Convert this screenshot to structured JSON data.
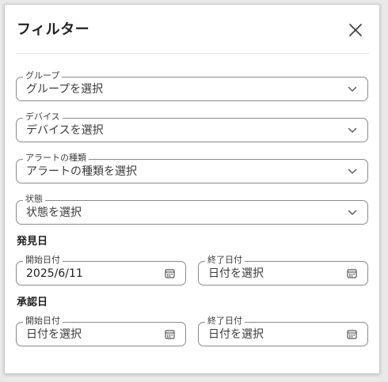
{
  "dialog": {
    "title": "フィルター",
    "close_icon": "close-icon"
  },
  "filters": {
    "group": {
      "label": "グループ",
      "placeholder": "グループを選択"
    },
    "device": {
      "label": "デバイス",
      "placeholder": "デバイスを選択"
    },
    "alert_type": {
      "label": "アラートの種類",
      "placeholder": "アラートの種類を選択"
    },
    "status": {
      "label": "状態",
      "placeholder": "状態を選択"
    }
  },
  "discovery_date": {
    "heading": "発見日",
    "start": {
      "label": "開始日付",
      "value": "2025/6/11"
    },
    "end": {
      "label": "終了日付",
      "placeholder": "日付を選択"
    }
  },
  "approval_date": {
    "heading": "承認日",
    "start": {
      "label": "開始日付",
      "placeholder": "日付を選択"
    },
    "end": {
      "label": "終了日付",
      "placeholder": "日付を選択"
    }
  },
  "icons": {
    "dropdown": "chevron-down-icon",
    "date": "calendar-icon"
  }
}
